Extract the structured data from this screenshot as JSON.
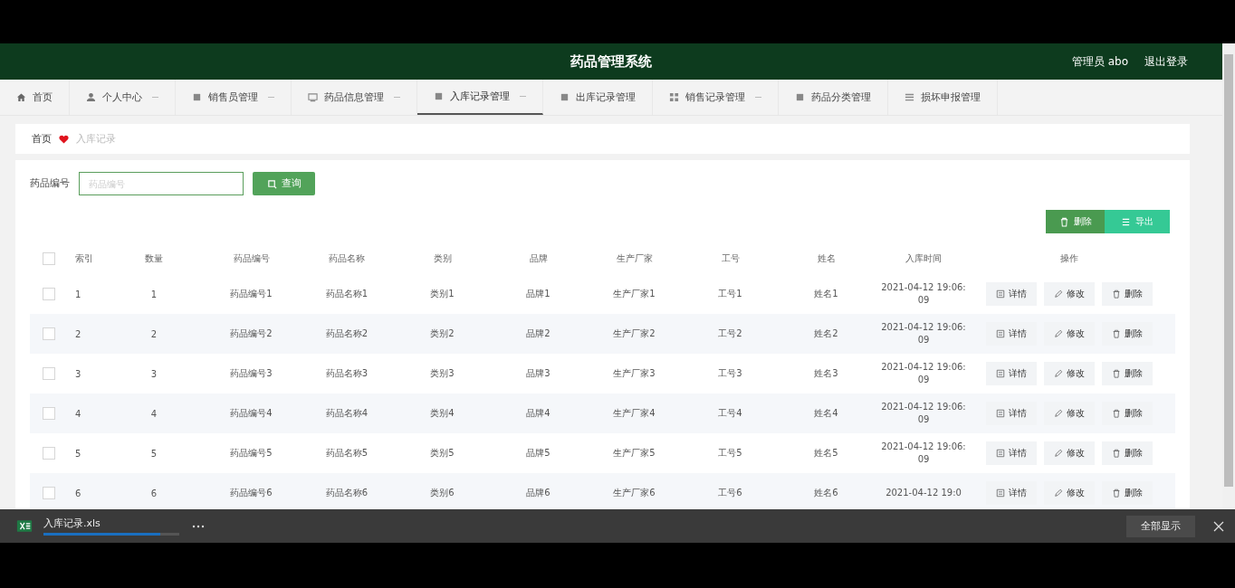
{
  "header": {
    "title": "药品管理系统",
    "user": "管理员 abo",
    "logout": "退出登录"
  },
  "tabs": [
    {
      "label": "首页",
      "selected": false,
      "dropdown": false
    },
    {
      "label": "个人中心",
      "selected": false,
      "dropdown": true
    },
    {
      "label": "销售员管理",
      "selected": false,
      "dropdown": true
    },
    {
      "label": "药品信息管理",
      "selected": false,
      "dropdown": true
    },
    {
      "label": "入库记录管理",
      "selected": true,
      "dropdown": true
    },
    {
      "label": "出库记录管理",
      "selected": false,
      "dropdown": false
    },
    {
      "label": "销售记录管理",
      "selected": false,
      "dropdown": true
    },
    {
      "label": "药品分类管理",
      "selected": false,
      "dropdown": false
    },
    {
      "label": "损坏申报管理",
      "selected": false,
      "dropdown": false
    }
  ],
  "breadcrumb": {
    "home": "首页",
    "current": "入库记录"
  },
  "search": {
    "label": "药品编号",
    "placeholder": "药品编号",
    "button": "查询"
  },
  "actions": [
    "删除",
    "导出"
  ],
  "table": {
    "header_checked": false,
    "columns": [
      "索引",
      "数量",
      "药品编号",
      "药品名称",
      "类别",
      "品牌",
      "生产厂家",
      "工号",
      "姓名",
      "入库时间",
      "操作"
    ],
    "rows": [
      {
        "checked": false,
        "cells": [
          "1",
          "1",
          "药品编号1",
          "药品名称1",
          "类别1",
          "品牌1",
          "生产厂家1",
          "工号1",
          "姓名1",
          "2021-04-12 19:06:09"
        ],
        "actions": [
          "详情",
          "修改",
          "删除"
        ]
      },
      {
        "checked": false,
        "cells": [
          "2",
          "2",
          "药品编号2",
          "药品名称2",
          "类别2",
          "品牌2",
          "生产厂家2",
          "工号2",
          "姓名2",
          "2021-04-12 19:06:09"
        ],
        "actions": [
          "详情",
          "修改",
          "删除"
        ]
      },
      {
        "checked": false,
        "cells": [
          "3",
          "3",
          "药品编号3",
          "药品名称3",
          "类别3",
          "品牌3",
          "生产厂家3",
          "工号3",
          "姓名3",
          "2021-04-12 19:06:09"
        ],
        "actions": [
          "详情",
          "修改",
          "删除"
        ]
      },
      {
        "checked": false,
        "cells": [
          "4",
          "4",
          "药品编号4",
          "药品名称4",
          "类别4",
          "品牌4",
          "生产厂家4",
          "工号4",
          "姓名4",
          "2021-04-12 19:06:09"
        ],
        "actions": [
          "详情",
          "修改",
          "删除"
        ]
      },
      {
        "checked": false,
        "cells": [
          "5",
          "5",
          "药品编号5",
          "药品名称5",
          "类别5",
          "品牌5",
          "生产厂家5",
          "工号5",
          "姓名5",
          "2021-04-12 19:06:09"
        ],
        "actions": [
          "详情",
          "修改",
          "删除"
        ]
      },
      {
        "checked": false,
        "cells": [
          "6",
          "6",
          "药品编号6",
          "药品名称6",
          "类别6",
          "品牌6",
          "生产厂家6",
          "工号6",
          "姓名6",
          "2021-04-12 19:0"
        ],
        "actions": [
          "详情",
          "修改",
          "删除"
        ]
      }
    ]
  },
  "download": {
    "file": "入库记录.xls",
    "level": 0.86,
    "show_all": "全部显示"
  }
}
